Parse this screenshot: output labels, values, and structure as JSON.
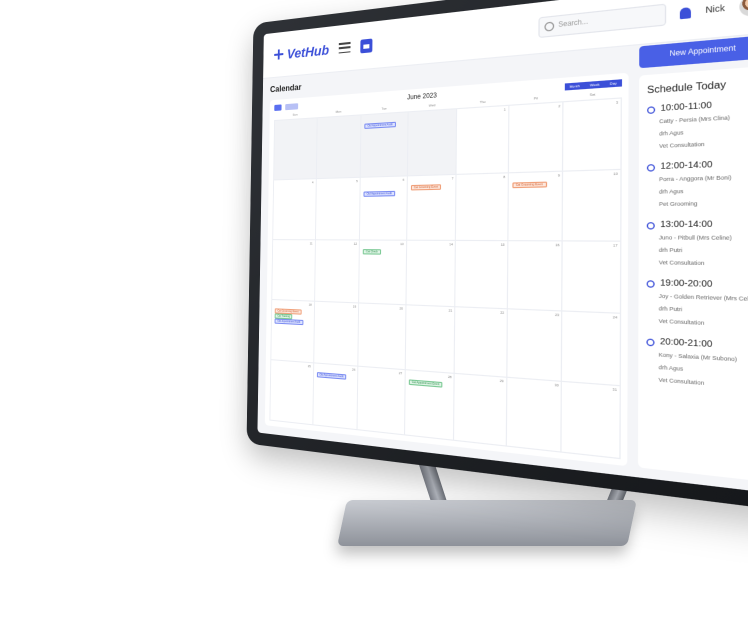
{
  "app": {
    "logo": "VetHub"
  },
  "topbar": {
    "search_placeholder": "Search...",
    "user_name": "Nick"
  },
  "page": {
    "title": "Calendar",
    "new_button": "New Appointment"
  },
  "calendar": {
    "month_label": "June 2023",
    "views": [
      "Month",
      "Week",
      "Day"
    ],
    "weekdays": [
      "Sun",
      "Mon",
      "Tue",
      "Wed",
      "Thu",
      "Fri",
      "Sat"
    ],
    "weeks": [
      [
        "",
        "",
        "",
        "",
        "1",
        "2",
        "3"
      ],
      [
        "4",
        "5",
        "6",
        "7",
        "8",
        "9",
        "10"
      ],
      [
        "11",
        "12",
        "13",
        "14",
        "15",
        "16",
        "17"
      ],
      [
        "18",
        "19",
        "20",
        "21",
        "22",
        "23",
        "24"
      ],
      [
        "25",
        "26",
        "27",
        "28",
        "29",
        "30",
        "31"
      ]
    ],
    "events": [
      {
        "label": "Old Appointment Audit",
        "color": "blue"
      },
      {
        "label": "Cat Grooming Event",
        "color": "orange"
      },
      {
        "label": "Old Appointment Audit",
        "color": "blue"
      },
      {
        "label": "Cat Grooming Event",
        "color": "orange"
      },
      {
        "label": "Cat Check",
        "color": "green"
      },
      {
        "label": "Cat Grooming Event",
        "color": "orange"
      },
      {
        "label": "Cat Training",
        "color": "green"
      },
      {
        "label": "Old Appointment Audit",
        "color": "blue"
      },
      {
        "label": "Old Appointment Audit",
        "color": "blue"
      },
      {
        "label": "Cat Appointment Event",
        "color": "green"
      }
    ]
  },
  "schedule": {
    "title": "Schedule Today",
    "items": [
      {
        "time": "10:00-11:00",
        "pet": "Catty - Persia (Mrs Clina)",
        "doctor": "drh Agus",
        "service": "Vet Consultation"
      },
      {
        "time": "12:00-14:00",
        "pet": "Porra - Anggora (Mr Boni)",
        "doctor": "drh Agus",
        "service": "Pet Grooming"
      },
      {
        "time": "13:00-14:00",
        "pet": "Juno - Pitbull (Mrs Celine)",
        "doctor": "drh Putri",
        "service": "Vet Consultation"
      },
      {
        "time": "19:00-20:00",
        "pet": "Joy - Golden Retriever (Mrs Celine)",
        "doctor": "drh Putri",
        "service": "Vet Consultation"
      },
      {
        "time": "20:00-21:00",
        "pet": "Kony - Salaxia (Mr Subono)",
        "doctor": "drh Agus",
        "service": "Vet Consultation"
      }
    ]
  }
}
